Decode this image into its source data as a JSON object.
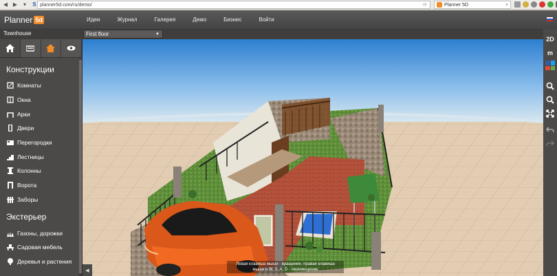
{
  "browser": {
    "url": "planner5d.com/ru/demo/",
    "tab_title": "Planner 5D",
    "back_icon": "back-arrow-icon",
    "forward_icon": "forward-arrow-icon"
  },
  "header": {
    "logo_text": "Planner",
    "logo_badge": "5d",
    "nav": [
      "Идеи",
      "Журнал",
      "Галерея",
      "Демо",
      "Бизнес",
      "Войти"
    ]
  },
  "project": {
    "name": "Townhouse",
    "floor": "First floor"
  },
  "sidebar": {
    "tabs": [
      {
        "icon": "home-icon",
        "active": true
      },
      {
        "icon": "sofa-icon",
        "active": false
      },
      {
        "icon": "roof-icon",
        "active": false
      },
      {
        "icon": "eye-icon",
        "active": false
      }
    ],
    "section_constructions": "Конструкции",
    "constructions": [
      "Комнаты",
      "Окна",
      "Арки",
      "Двери",
      "Перегородки",
      "Лестницы",
      "Колонны",
      "Ворота",
      "Заборы"
    ],
    "section_exterior": "Экстерьер",
    "exterior": [
      "Газоны, дорожки",
      "Садовая мебель",
      "Деревья и растения"
    ]
  },
  "right_toolbar": {
    "view_2d": "2D",
    "mode_m": "m"
  },
  "hint": {
    "line1": "Левая клавиша мыши - вращение, правая клавиша",
    "line2": "мыши и W, S, A, D - перемещение"
  },
  "colors": {
    "accent": "#f28c28",
    "panel": "#4b4a49",
    "header": "#4f4e4e"
  }
}
